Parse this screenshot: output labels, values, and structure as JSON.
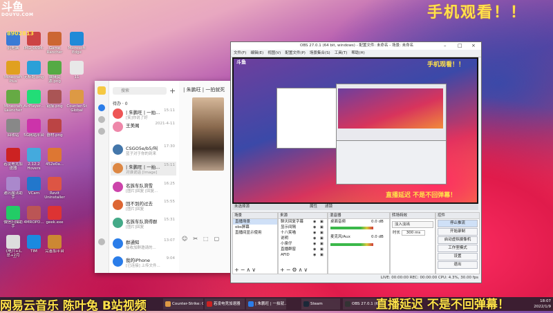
{
  "watermark": {
    "logo": "斗鱼",
    "logo_sub": "DOUYU.COM",
    "room": "8902813",
    "top_right": "手机观看！！",
    "bottom_left": "网易云音乐 陈叶兔 B站视频",
    "bottom_right": "直播延迟 不是不回弹幕！"
  },
  "desktop": {
    "icons": [
      {
        "label": "此电脑",
        "color": "#3a7bd5"
      },
      {
        "label": "IMG_0094...",
        "color": "#c44"
      },
      {
        "label": "Game Rancher",
        "color": "#c63"
      },
      {
        "label": "Microsoft Edge",
        "color": "#1f8ad8"
      },
      {
        "label": "Minecraft Plus",
        "color": "#e0a020"
      },
      {
        "label": "无标题.png",
        "color": "#2aa0d8"
      },
      {
        "label": "编辑资源.png",
        "color": "#5a4"
      },
      {
        "label": "11",
        "color": "#e8e8e8"
      },
      {
        "label": "Minecraft Launcher",
        "color": "#6a4"
      },
      {
        "label": "AirPlayer...",
        "color": "#2d7"
      },
      {
        "label": "链接.png",
        "color": "#a55"
      },
      {
        "label": "Counter-St Global Off...",
        "color": "#d94"
      },
      {
        "label": "回收站",
        "color": "#888"
      },
      {
        "label": "5G网站平台",
        "color": "#c3a"
      },
      {
        "label": "器材.png",
        "color": "#b44"
      },
      {
        "label": "若凌电竞加速器",
        "color": "#c22"
      },
      {
        "label": "2.12.2 Hovers",
        "color": "#4ad"
      },
      {
        "label": "452e0a...",
        "color": "#d73"
      },
      {
        "label": "通讯魔法助手",
        "color": "#a8c"
      },
      {
        "label": "VCam",
        "color": "#27c"
      },
      {
        "label": "Revit Uninstaller",
        "color": "#d54"
      },
      {
        "label": "微信扫描助手",
        "color": "#2c6"
      },
      {
        "label": "4MROPD...",
        "color": "#b55"
      },
      {
        "label": "geek.exe",
        "color": "#d33"
      },
      {
        "label": "《电穴+汇总+2月8+更..",
        "color": "#ddd"
      },
      {
        "label": "TIM",
        "color": "#1b8ae0"
      },
      {
        "label": "完善加平台",
        "color": "#c83"
      }
    ]
  },
  "chat": {
    "search_placeholder": "搜索",
    "plus": "+",
    "pending": "待办 · 0",
    "title": "| 朱鹏旺 | 一拍就死",
    "items": [
      {
        "name": "| 朱鹏旺 | 一拍...",
        "time": "15:11",
        "preview": "[笑]你说了好",
        "color": "#e55"
      },
      {
        "name": "王美阁",
        "time": "2021-4-11",
        "preview": "",
        "color": "#e8a"
      },
      {
        "name": "CSGO5e/b5/叫",
        "time": "17:30",
        "preview": "蓝子对于你的到来",
        "color": "#47a"
      },
      {
        "name": "| 朱鹏旺 | 一拍...",
        "time": "15:11",
        "preview": "对谁说话 [Image]",
        "color": "#d84"
      },
      {
        "name": "名族车队滑雪",
        "time": "16:25",
        "preview": "[图片]回复 [回复...",
        "color": "#c4a"
      },
      {
        "name": "回不到的过去",
        "time": "15:55",
        "preview": "[图片]回复",
        "color": "#d63"
      },
      {
        "name": "名族车队滑得群",
        "time": "15:31",
        "preview": "[图片]回复",
        "color": "#4a8"
      },
      {
        "name": "群通知",
        "time": "13:07",
        "preview": "接收加群邀请的...",
        "color": "#2b7de9"
      },
      {
        "name": "我的iPhone",
        "time": "9:04",
        "preview": "[已连接] 上传文件...",
        "color": "#2b7de9"
      }
    ],
    "tools": [
      "☺",
      "✂",
      "⬚",
      "▢"
    ]
  },
  "obs": {
    "title": "OBS 27.0.1 (64 bit, windows) - 配置文件: 未命名 - 场景: 未命名",
    "menu": [
      "文件(F)",
      "编辑(E)",
      "视图(V)",
      "配置文件(P)",
      "场景集合(S)",
      "工具(T)",
      "帮助(H)"
    ],
    "source_bar": "未选择源",
    "source_bar_props": "属性",
    "source_bar_filters": "滤镜",
    "scenes": {
      "title": "场景",
      "items": [
        "直播场景",
        "obs屏幕",
        "直播间显示使用"
      ]
    },
    "sources": {
      "title": "来源",
      "items": [
        "聊天回复字幕",
        "显示间隔",
        "十八笑喵",
        "说明",
        "小泉仔",
        "直播群窗",
        "AFID"
      ]
    },
    "mixer": {
      "title": "混音器",
      "ch1": "桌面音频",
      "ch1_db": "0.0 dB",
      "ch2": "麦克风/Aux",
      "ch2_db": "0.0 dB"
    },
    "transitions": {
      "title": "转场特效",
      "type": "淡入淡出",
      "dur_label": "时长",
      "dur": "300 ms"
    },
    "controls": {
      "title": "控件",
      "buttons": [
        "停止推流",
        "开始录制",
        "启动虚拟摄像机",
        "工作室模式",
        "设置",
        "退出"
      ]
    },
    "status": "LIVE: 00:00:00  REC: 00:00:00  CPU: 4.3%, 30.00 fps",
    "preview_text1": "手机观看！！",
    "preview_text2": "直播延迟 不是不回弹幕！"
  },
  "taskbar": {
    "items": [
      {
        "label": "Counter-Strike: Gl...",
        "color": "#d94"
      },
      {
        "label": "若凌电竞加速器",
        "color": "#c22"
      },
      {
        "label": "| 朱鹏旺 | 一拍就...",
        "color": "#2b7de9"
      },
      {
        "label": "Steam",
        "color": "#1b2838"
      },
      {
        "label": "OBS 27.0.1 (64 bit...",
        "color": "#333"
      }
    ],
    "time": "18:07",
    "date": "2022/1/9"
  }
}
